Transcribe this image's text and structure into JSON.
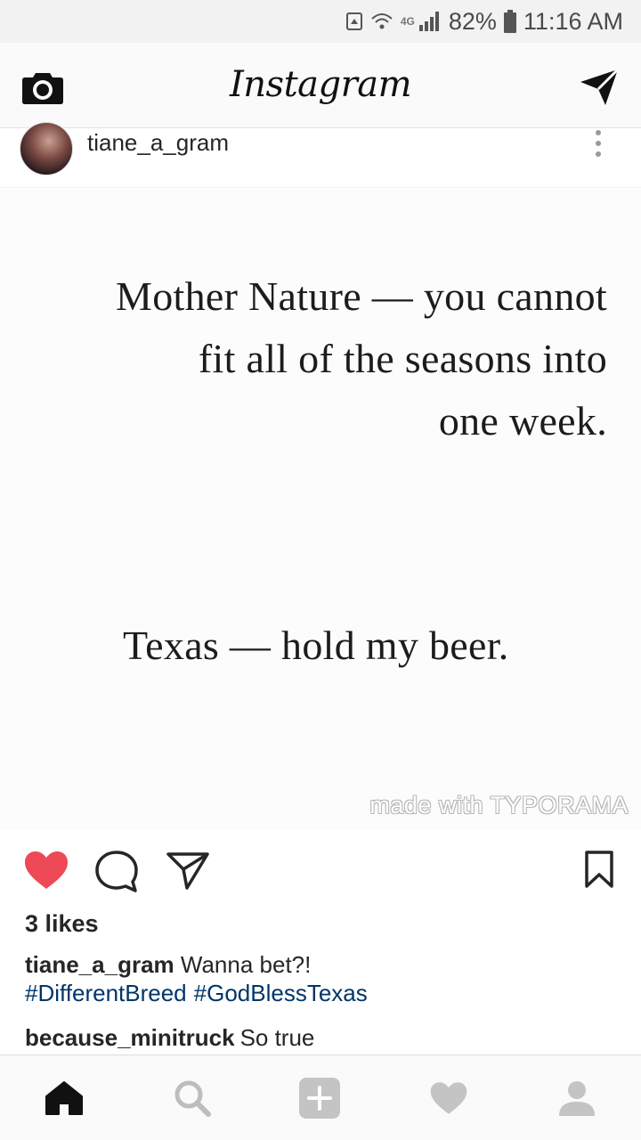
{
  "status_bar": {
    "network_label": "4G",
    "battery": "82%",
    "time": "11:16 AM"
  },
  "header": {
    "logo": "Instagram",
    "camera_icon": "camera-icon",
    "direct_icon": "paper-plane-icon"
  },
  "post": {
    "username": "tiane_a_gram",
    "more_icon": "more-vertical-icon",
    "image_text": {
      "lines_top": [
        "Mother Nature — you cannot",
        "fit all of the seasons into",
        "one week."
      ],
      "line_bottom": "Texas — hold my beer.",
      "watermark": "made with TYPORAMA"
    },
    "actions": {
      "like_icon": "heart-filled-icon",
      "comment_icon": "comment-icon",
      "share_icon": "paper-plane-icon",
      "save_icon": "bookmark-icon"
    },
    "likes": "3 likes",
    "caption": {
      "username": "tiane_a_gram",
      "text": "Wanna bet?!",
      "hashtags": [
        "#DifferentBreed",
        "#GodBlessTexas"
      ]
    },
    "comments": [
      {
        "username": "because_minitruck",
        "text": "So true"
      }
    ]
  },
  "bottom_nav": {
    "items": [
      "home-icon",
      "search-icon",
      "add-icon",
      "heart-icon",
      "profile-icon"
    ]
  },
  "colors": {
    "like_red": "#ed4956",
    "hashtag_blue": "#003569",
    "text_dark": "#262626"
  }
}
